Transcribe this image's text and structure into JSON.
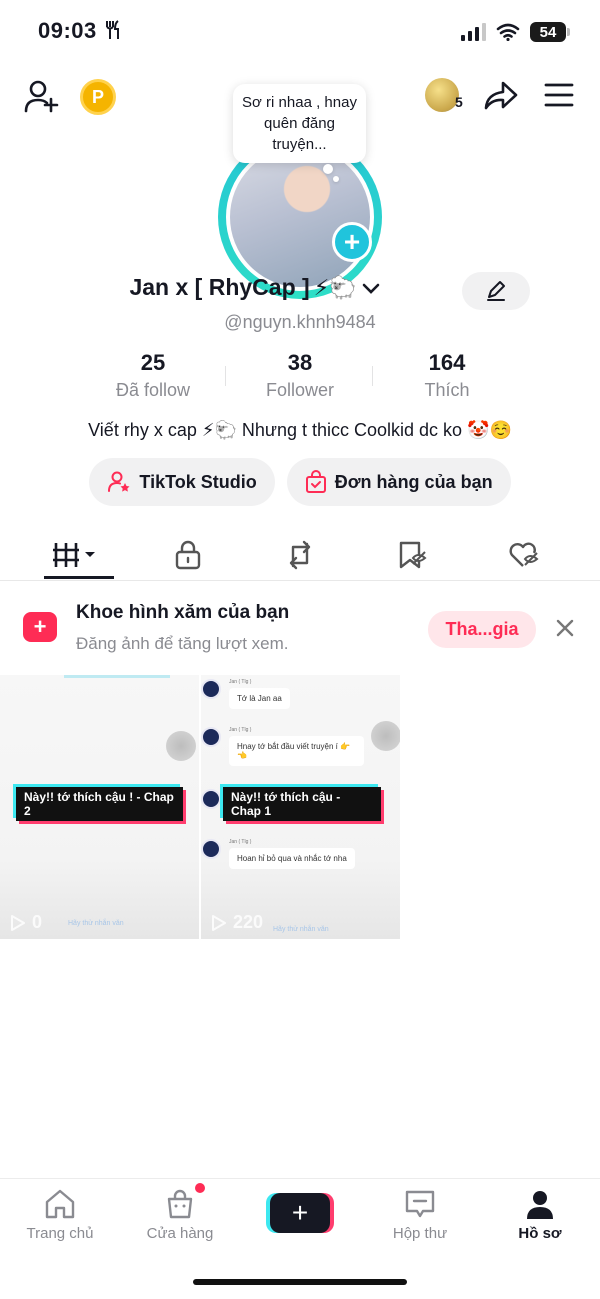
{
  "status_bar": {
    "time": "09:03",
    "battery": "54"
  },
  "header": {
    "coin_letter": "P",
    "friends_count": "5"
  },
  "profile": {
    "bubble_text": "Sơ ri nhaa , hnay quên đăng truyện...",
    "display_name": "Jan x [ RhyCap ]",
    "name_emoji": "⚡🐑",
    "username": "@nguyn.khnh9484",
    "bio": "Viết rhy x cap ⚡🐑 Nhưng t thicc Coolkid dc ko 🤡☺️"
  },
  "stats": [
    {
      "value": "25",
      "label": "Đã follow"
    },
    {
      "value": "38",
      "label": "Follower"
    },
    {
      "value": "164",
      "label": "Thích"
    }
  ],
  "buttons": {
    "studio": "TikTok Studio",
    "orders": "Đơn hàng của bạn"
  },
  "tabs": [
    {
      "icon": "grid-icon",
      "active": true
    },
    {
      "icon": "lock-icon"
    },
    {
      "icon": "repost-icon"
    },
    {
      "icon": "bookmark-icon"
    },
    {
      "icon": "liked-icon"
    }
  ],
  "banner": {
    "title": "Khoe hình xăm của bạn",
    "subtitle": "Đăng ảnh để tăng lượt xem.",
    "join_label": "Tha...gia"
  },
  "videos": [
    {
      "cover_title": "Này!! tớ thích cậu ! - Chap 2",
      "views": "0",
      "faint": "Hãy thử nhắn văn"
    },
    {
      "cover_title": "Này!! tớ thích cậu - Chap 1",
      "views": "220",
      "faint": "Hãy thử nhắn văn",
      "chat": [
        {
          "name": "Jan ( Tlg )",
          "msg": "Tớ là Jan aa"
        },
        {
          "name": "Jan ( Tlg )",
          "msg": "Hnay tớ bắt đầu viết truyện í 👉👈"
        },
        {
          "name": "Jan ( Tlg )",
          "msg": "Hoan hỉ bỏ qua và nhắc tớ nha"
        }
      ]
    }
  ],
  "nav": [
    {
      "label": "Trang chủ",
      "icon": "home-icon"
    },
    {
      "label": "Cửa hàng",
      "icon": "shop-icon"
    },
    {
      "label": "+",
      "icon": "create-icon"
    },
    {
      "label": "Hộp thư",
      "icon": "inbox-icon"
    },
    {
      "label": "Hồ sơ",
      "icon": "profile-icon",
      "active": true
    }
  ],
  "colors": {
    "accent": "#fe2c55",
    "cyan": "#20c4dc",
    "text": "#161823",
    "muted": "#8a8b91"
  }
}
